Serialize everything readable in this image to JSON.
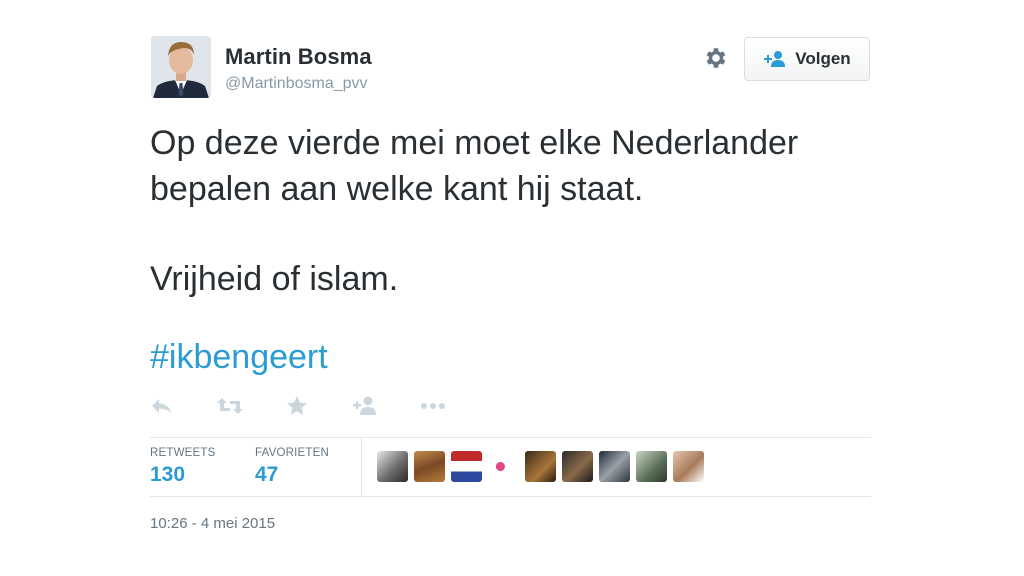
{
  "user": {
    "display_name": "Martin Bosma",
    "handle": "@Martinbosma_pvv",
    "avatar": "profile-photo"
  },
  "header": {
    "settings_icon": "gear-icon",
    "follow_label": "Volgen",
    "follow_icon": "add-user-icon"
  },
  "tweet": {
    "lines": [
      "Op deze vierde mei moet elke Nederlander",
      "bepalen aan welke kant hij staat.",
      "Vrijheid of islam."
    ],
    "hashtag": "#ikbengeert"
  },
  "actions": [
    "reply-icon",
    "retweet-icon",
    "favorite-icon",
    "follow-icon",
    "more-icon"
  ],
  "stats": {
    "retweets_label": "RETWEETS",
    "retweets_count": "130",
    "favorites_label": "FAVORIETEN",
    "favorites_count": "47"
  },
  "favoriters": [
    "face-1",
    "face-2",
    "face-3",
    "face-4",
    "face-5",
    "face-6",
    "face-7",
    "face-8",
    "face-9"
  ],
  "timestamp": "10:26 - 4 mei 2015",
  "colors": {
    "text": "#292f33",
    "link": "#2b9bd4",
    "muted": "#8899a6",
    "icon": "#ccd6dd",
    "border": "#e1e8ed"
  }
}
